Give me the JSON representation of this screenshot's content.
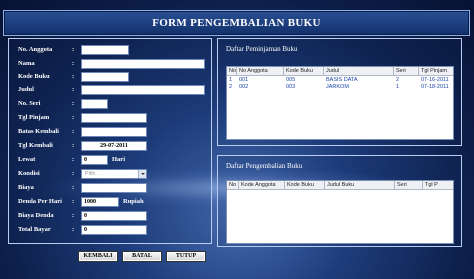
{
  "title": "FORM PENGEMBALIAN BUKU",
  "form": {
    "labels": {
      "no_anggota": "No. Anggota",
      "nama": "Nama",
      "kode_buku": "Kode Buku",
      "judul": "Judul",
      "no_seri": "No. Seri",
      "tgl_pinjam": "Tgl Pinjam",
      "batas_kembali": "Batas Kembali",
      "tgl_kembali": "Tgl Kembali",
      "lewat": "Lewat",
      "kondisi": "Kondisi",
      "biaya": "Biaya",
      "denda_per_hari": "Denda Per Hari",
      "biaya_denda": "Biaya Denda",
      "total_bayar": "Total Bayar"
    },
    "colon": ":",
    "values": {
      "tgl_kembali": "29-07-2011",
      "lewat": "0",
      "denda_per_hari": "1000",
      "biaya_denda": "0",
      "total_bayar": "0"
    },
    "kondisi_placeholder": "Pilih . .",
    "hari_suffix": "Hari",
    "rupiah_suffix": "Rupiah"
  },
  "peminjaman": {
    "title": "Daftar Peminjaman Buku",
    "columns": [
      "No",
      "No Anggota",
      "Kode Buku",
      "Judul",
      "Seri",
      "Tgl Pinjam"
    ],
    "rows": [
      [
        "1",
        "001",
        "005",
        "BASIS DATA",
        "2",
        "07-16-2011"
      ],
      [
        "2",
        "002",
        "003",
        "JARKOM",
        "1",
        "07-18-2011"
      ]
    ]
  },
  "pengembalian": {
    "title": "Daftar Pengembalian Buku",
    "columns": [
      "No",
      "Kode Anggota",
      "Kode Buku",
      "Judul Buku",
      "Seri",
      "Tgl P"
    ]
  },
  "buttons": {
    "kembali": "KEMBALI",
    "batal": "BATAL",
    "tutup": "TUTUP"
  }
}
